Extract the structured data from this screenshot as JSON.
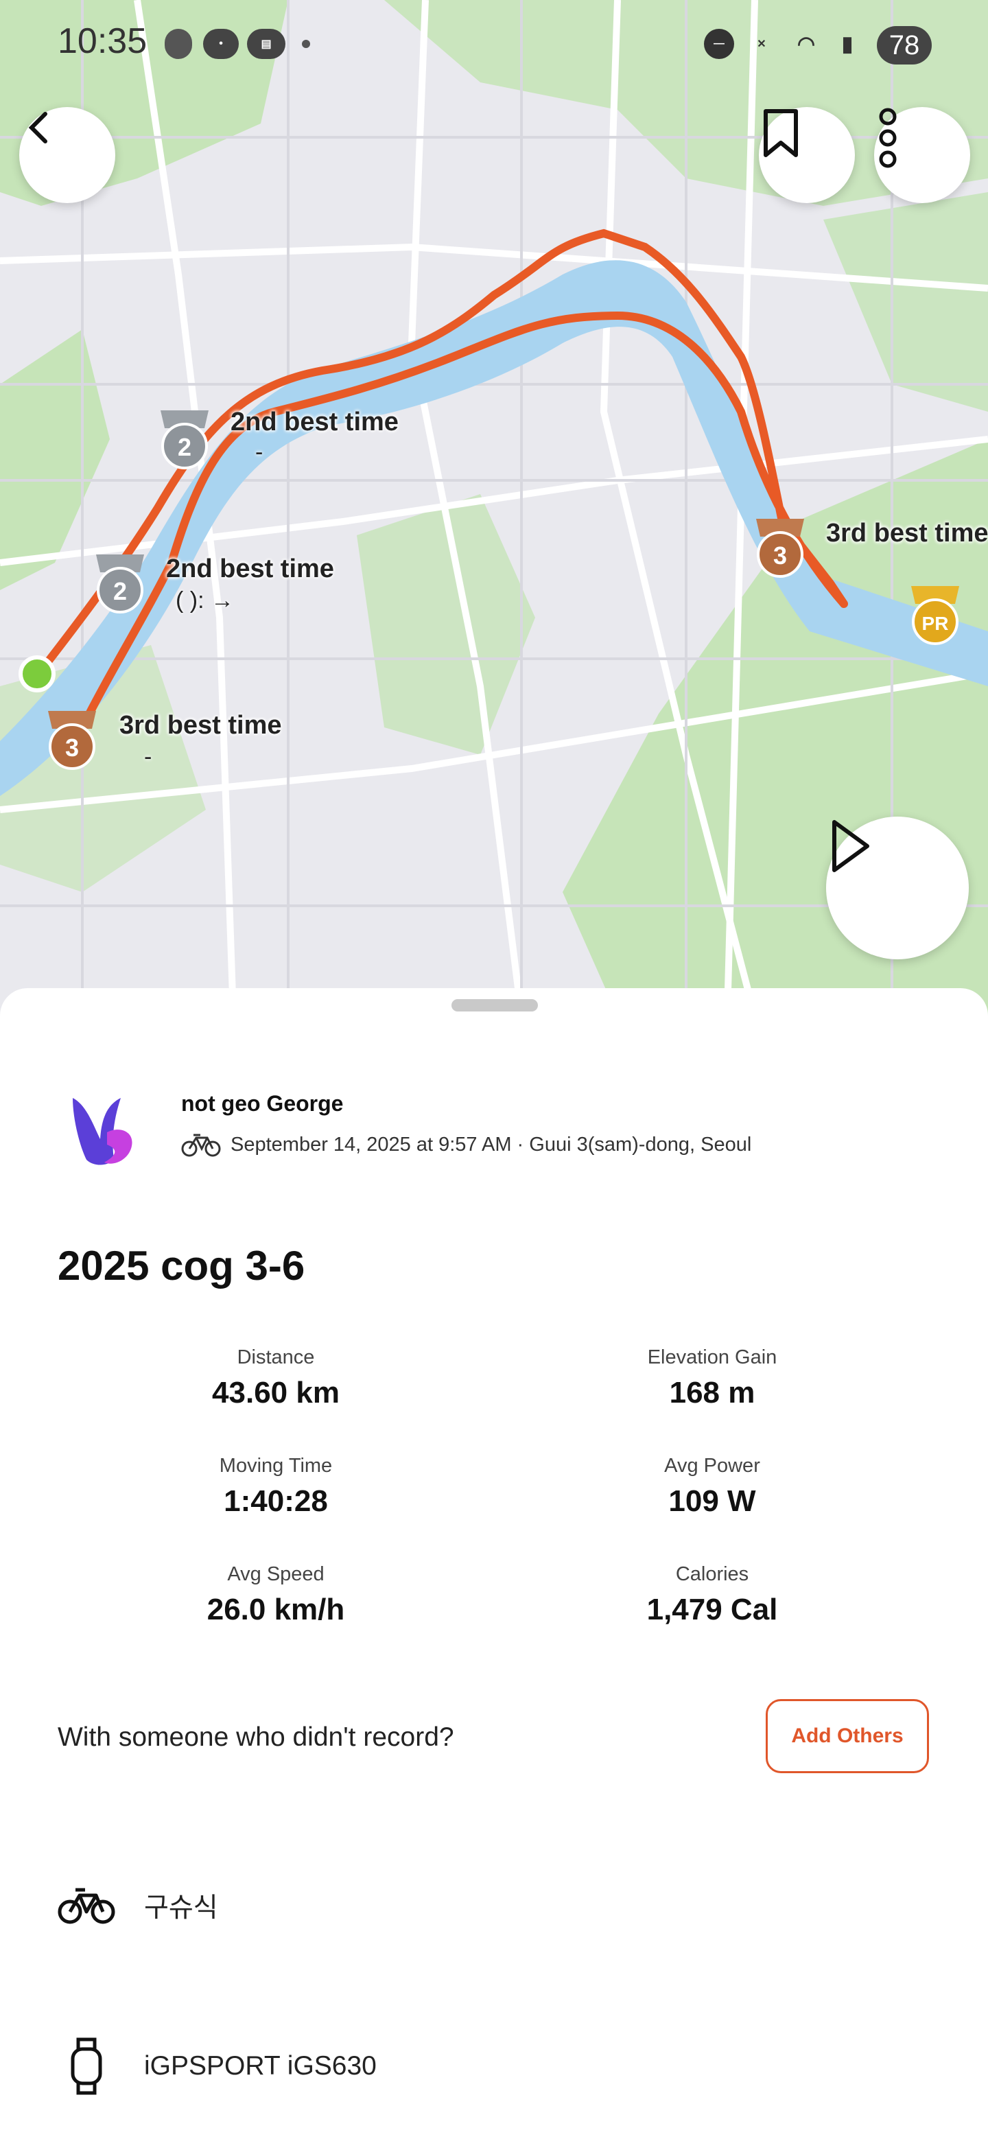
{
  "status_bar": {
    "time": "10:35",
    "battery": "78"
  },
  "map": {
    "labels": [
      {
        "title": "2nd best time",
        "detail": "-"
      },
      {
        "title": "2nd best time",
        "detail": "( ):    →"
      },
      {
        "title": "3rd best time",
        "detail": "-"
      },
      {
        "title": "3rd best time",
        "detail": ""
      }
    ],
    "medal_numbers": {
      "second": "2",
      "third": "3",
      "pr": "PR"
    }
  },
  "athlete": {
    "name": "not geo George",
    "meta": "September 14, 2025 at 9:57 AM · Guui 3(sam)-dong, Seoul"
  },
  "activity": {
    "title": "2025 cog 3-6"
  },
  "stats": [
    {
      "label": "Distance",
      "value": "43.60 km"
    },
    {
      "label": "Elevation Gain",
      "value": "168 m"
    },
    {
      "label": "Moving Time",
      "value": "1:40:28"
    },
    {
      "label": "Avg Power",
      "value": "109 W"
    },
    {
      "label": "Avg Speed",
      "value": "26.0 km/h"
    },
    {
      "label": "Calories",
      "value": "1,479 Cal"
    }
  ],
  "together": {
    "prompt": "With someone who didn't record?",
    "button": "Add Others"
  },
  "gear": [
    {
      "icon": "bike-icon",
      "name": "구슈식"
    },
    {
      "icon": "watch-icon",
      "name": "iGPSPORT iGS630"
    }
  ],
  "colors": {
    "accent": "#e0562a",
    "route": "#e85a26",
    "water": "#a9d4f0",
    "park": "#bfe0b0"
  }
}
